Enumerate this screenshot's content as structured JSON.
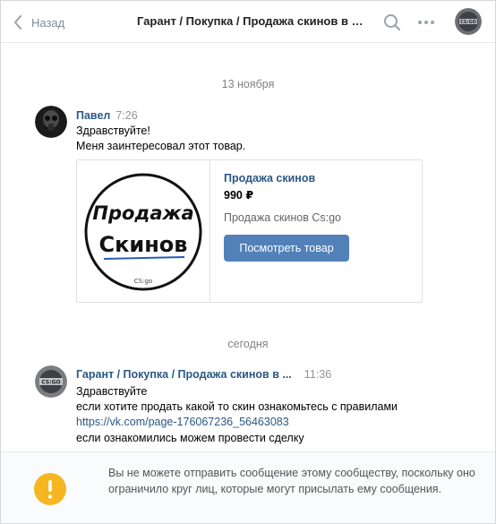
{
  "header": {
    "back_label": "Назад",
    "title": "Гарант / Покупка / Продажа скинов в Cs:go",
    "icons": [
      "chevron-left-icon",
      "search-icon",
      "more-icon",
      "community-avatar"
    ]
  },
  "dates": {
    "first": "13 ноября",
    "second": "сегодня"
  },
  "messages": [
    {
      "author": "Павел",
      "time": "7:26",
      "lines": [
        "Здравствуйте!",
        "Меня заинтересовал этот товар."
      ]
    },
    {
      "author": "Гарант / Покупка / Продажа скинов в ...",
      "time": "11:36",
      "lines": [
        "Здравствуйте",
        "если хотите продать какой то скин ознакомьтесь с правилами",
        "https://vk.com/page-176067236_56463083",
        "если ознакомились можем провести сделку"
      ]
    }
  ],
  "product": {
    "image_text_line1": "Продажа",
    "image_text_line2": "Скинов",
    "image_text_small": "CS:go",
    "title": "Продажа скинов",
    "price": "990 ₽",
    "description": "Продажа скинов Cs:go",
    "button_label": "Посмотреть товар"
  },
  "notice": {
    "text": "Вы не можете отправить сообщение этому сообществу, поскольку оно ограничило круг лиц, которые могут присылать ему сообщения."
  },
  "colors": {
    "link": "#2a5885",
    "button": "#5181b8",
    "warning": "#f5b621",
    "muted": "#828282"
  }
}
